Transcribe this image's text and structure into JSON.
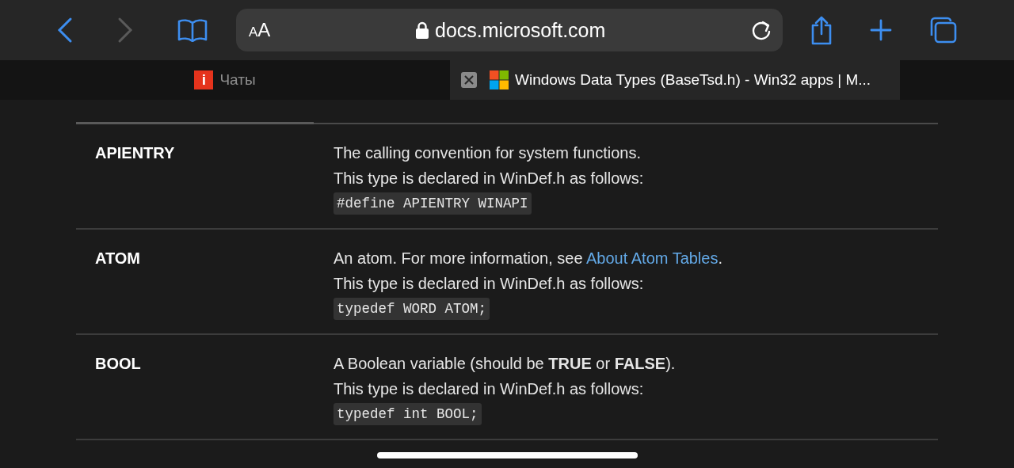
{
  "toolbar": {
    "back_enabled": true,
    "forward_enabled": false,
    "text_size_label": "AA",
    "address": "docs.microsoft.com",
    "secure": true
  },
  "tabs": [
    {
      "title": "Чаты",
      "selected": false,
      "kind": "letter",
      "favicon_letter": "i"
    },
    {
      "title": "Windows Data Types (BaseTsd.h) - Win32 apps | M...",
      "selected": true,
      "kind": "windows"
    }
  ],
  "table": {
    "rows": [
      {
        "data_type": "APIENTRY",
        "description": [
          {
            "kind": "text",
            "text": "The calling convention for system functions."
          }
        ],
        "declared": "This type is declared in WinDef.h as follows:",
        "code": "#define APIENTRY WINAPI"
      },
      {
        "data_type": "ATOM",
        "description": [
          {
            "kind": "text",
            "text": "An atom. For more information, see "
          },
          {
            "kind": "link",
            "text": "About Atom Tables"
          },
          {
            "kind": "text",
            "text": "."
          }
        ],
        "declared": "This type is declared in WinDef.h as follows:",
        "code": "typedef WORD ATOM;"
      },
      {
        "data_type": "BOOL",
        "description": [
          {
            "kind": "text",
            "text": "A Boolean variable (should be **TRUE** or **FALSE**)."
          }
        ],
        "declared": "This type is declared in WinDef.h as follows:",
        "code": "typedef int BOOL;"
      }
    ]
  }
}
